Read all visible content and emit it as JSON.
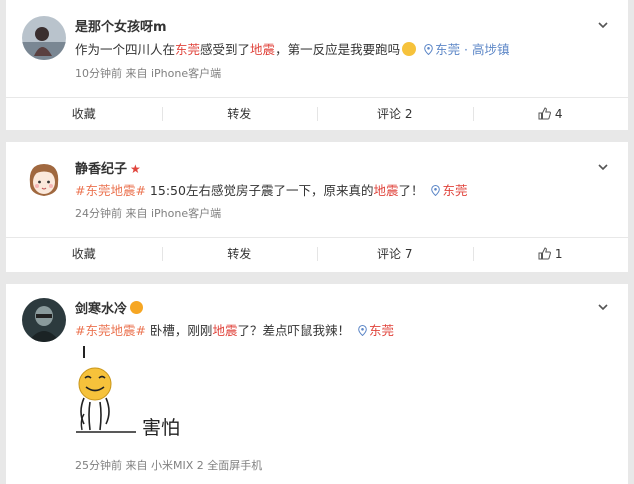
{
  "posts": [
    {
      "user": "是那个女孩呀m",
      "text_parts": {
        "pre": "作为一个四川人在",
        "place": "东莞",
        "mid": "感受到了",
        "quake": "地震",
        "post": "，第一反应是我要跑吗"
      },
      "location": "东莞 · 高埗镇",
      "meta": "10分钟前 来自 iPhone客户端",
      "actions": {
        "fav": "收藏",
        "share": "转发",
        "comment": "评论 2",
        "like": "4"
      }
    },
    {
      "user": "静香纪子",
      "text_parts": {
        "tag": "#东莞地震#",
        "pre": " 15:50左右感觉房子震了一下，原来真的",
        "quake": "地震",
        "post": "了！"
      },
      "location": "东莞",
      "meta": "24分钟前 来自 iPhone客户端",
      "actions": {
        "fav": "收藏",
        "share": "转发",
        "comment": "评论 7",
        "like": "1"
      }
    },
    {
      "user": "剑寒水冷",
      "text_parts": {
        "tag": "#东莞地震#",
        "pre": " 卧槽，刚刚",
        "quake": "地震",
        "post": "了？差点吓鼠我辣！"
      },
      "location": "东莞",
      "sticker_caption": "害怕",
      "meta": "25分钟前 来自 小米MIX 2 全面屏手机"
    }
  ],
  "colors": {
    "accent_red": "#e0443c",
    "topic": "#eb7350",
    "location": "#5d87c7"
  },
  "icons": [
    "chevron-down-icon",
    "location-pin-icon",
    "thumbs-up-icon",
    "emoji-face-icon",
    "star-badge-icon"
  ]
}
